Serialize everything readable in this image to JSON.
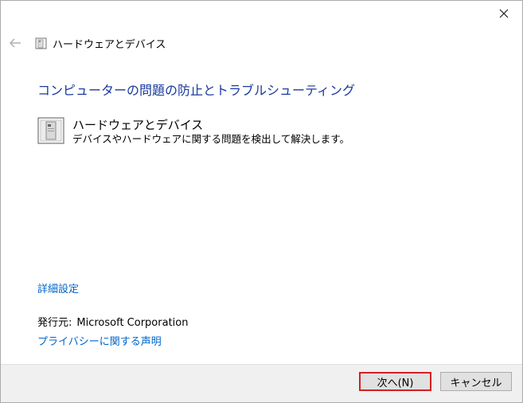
{
  "window": {
    "header_title": "ハードウェアとデバイス"
  },
  "main": {
    "page_title": "コンピューターの問題の防止とトラブルシューティング",
    "item": {
      "title": "ハードウェアとデバイス",
      "description": "デバイスやハードウェアに関する問題を検出して解決します。"
    },
    "advanced_link": "詳細設定",
    "publisher_label": "発行元:",
    "publisher_value": "Microsoft Corporation",
    "privacy_link": "プライバシーに関する声明"
  },
  "footer": {
    "next_label": "次へ(N)",
    "cancel_label": "キャンセル"
  },
  "icons": {
    "close": "close-icon",
    "back": "back-arrow-icon",
    "device": "hardware-device-icon"
  },
  "colors": {
    "title_blue": "#1a3a9e",
    "link_blue": "#0066cc",
    "highlight_red": "#d42020"
  }
}
